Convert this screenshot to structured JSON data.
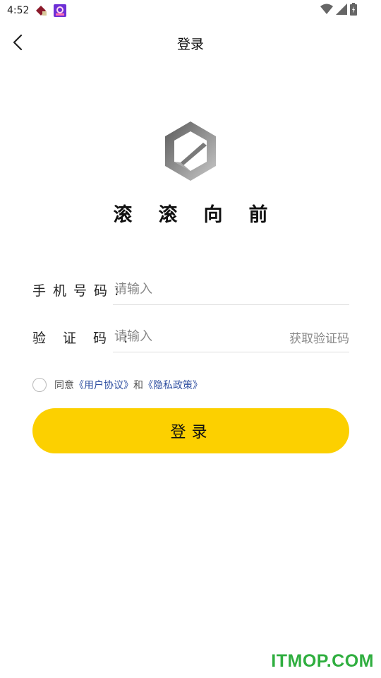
{
  "status_bar": {
    "time": "4:52",
    "icons": [
      "app-notification-icon",
      "app-notification-icon-2",
      "wifi-icon",
      "signal-icon",
      "battery-icon"
    ]
  },
  "nav": {
    "back_icon": "chevron-left-icon",
    "title": "登录"
  },
  "brand": {
    "name": "滚滚向前",
    "logo_colors": [
      "#5a5a5a",
      "#c9c9c9"
    ]
  },
  "form": {
    "phone": {
      "label": "手机号码:",
      "placeholder": "请输入",
      "value": ""
    },
    "code": {
      "label": "验证码:",
      "placeholder": "请输入",
      "value": "",
      "get_code_label": "获取验证码"
    }
  },
  "agreement": {
    "checked": false,
    "prefix": "同意",
    "user_agreement": "《用户协议》",
    "conjunction": "和",
    "privacy_policy": "《隐私政策》"
  },
  "login_button": {
    "label": "登录"
  },
  "watermark": "ITMOP.COM",
  "colors": {
    "accent": "#FCD000",
    "link": "#2f4fa1",
    "watermark": "#2fae3f"
  }
}
